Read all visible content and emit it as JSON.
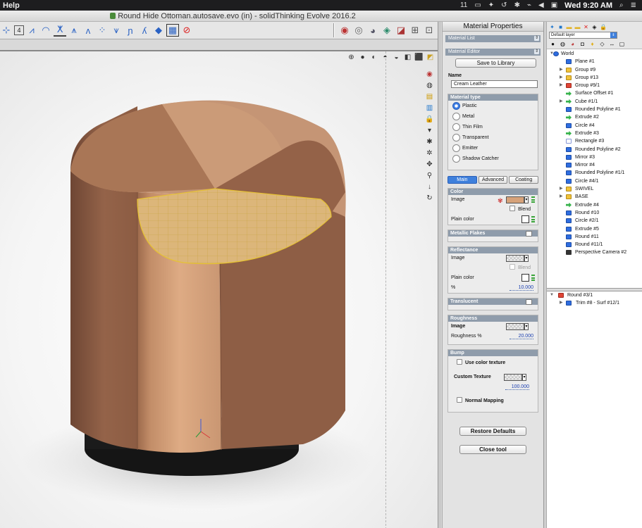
{
  "menubar": {
    "help": "Help",
    "status_items": [
      "11",
      "▭",
      "✦",
      "↺",
      "✱",
      "⌁",
      "◀",
      "▣"
    ],
    "clock": "Wed 9:20 AM",
    "search_icon": "⌕",
    "list_icon": "≣"
  },
  "window": {
    "title": "Round Hide Ottoman.autosave.evo (in) - solidThinking Evolve 2016.2"
  },
  "material": {
    "panel_title": "Material Properties",
    "material_list_label": "Material List",
    "material_editor_label": "Material Editor",
    "save_library": "Save to Library",
    "name_label": "Name",
    "name_value": "Cream Leather",
    "material_type_label": "Material type",
    "types": [
      "Plastic",
      "Metal",
      "Thin Film",
      "Transparent",
      "Emitter",
      "Shadow Catcher"
    ],
    "tabs": [
      "Main",
      "Advanced",
      "Coating"
    ],
    "color": {
      "header": "Color",
      "image_label": "Image",
      "blend_label": "Blend",
      "plain_color_label": "Plain color"
    },
    "metallic_flakes": "Metallic Flakes",
    "reflectance": {
      "header": "Reflectance",
      "image_label": "Image",
      "blend_label": "Blend",
      "plain_color_label": "Plain color",
      "percent_label": "%",
      "percent_value": "10.000"
    },
    "translucent": "Translucent",
    "roughness": {
      "header": "Roughness",
      "image_label": "Image",
      "percent_label": "Roughness %",
      "percent_value": "20.000"
    },
    "bump": {
      "header": "Bump",
      "use_color_texture": "Use color texture",
      "custom_texture": "Custom Texture",
      "value": "100.000",
      "normal_mapping": "Normal Mapping"
    },
    "restore_defaults": "Restore Defaults",
    "close_tool": "Close tool"
  },
  "tree": {
    "layer": "Default layer",
    "root": "World",
    "items": [
      {
        "label": "Plane #1",
        "icon": "blue",
        "exp": false
      },
      {
        "label": "Group #9",
        "icon": "folder",
        "exp": true
      },
      {
        "label": "Group #13",
        "icon": "folder",
        "exp": true
      },
      {
        "label": "Group #9/1",
        "icon": "folder-red",
        "exp": true
      },
      {
        "label": "Surface Offset #1",
        "icon": "green",
        "exp": false
      },
      {
        "label": "Cube #1/1",
        "icon": "green",
        "exp": true
      },
      {
        "label": "Rounded Polyline #1",
        "icon": "blue",
        "exp": false
      },
      {
        "label": "Extrude #2",
        "icon": "green",
        "exp": false
      },
      {
        "label": "Circle #4",
        "icon": "blue",
        "exp": false
      },
      {
        "label": "Extrude #3",
        "icon": "green",
        "exp": false
      },
      {
        "label": "Rectangle #3",
        "icon": "outline",
        "exp": false
      },
      {
        "label": "Rounded Polyline #2",
        "icon": "blue",
        "exp": false
      },
      {
        "label": "Mirror #3",
        "icon": "blue",
        "exp": false
      },
      {
        "label": "Mirror #4",
        "icon": "blue",
        "exp": false
      },
      {
        "label": "Rounded Polyline #1/1",
        "icon": "blue",
        "exp": false
      },
      {
        "label": "Circle #4/1",
        "icon": "blue",
        "exp": false
      },
      {
        "label": "SWIVEL",
        "icon": "folder",
        "exp": true
      },
      {
        "label": "BASE",
        "icon": "folder",
        "exp": true
      },
      {
        "label": "Extrude #4",
        "icon": "green",
        "exp": false
      },
      {
        "label": "Round #10",
        "icon": "blue",
        "exp": false
      },
      {
        "label": "Circle #2/1",
        "icon": "blue",
        "exp": false
      },
      {
        "label": "Extrude #5",
        "icon": "blue",
        "exp": false
      },
      {
        "label": "Round #11",
        "icon": "blue",
        "exp": false
      },
      {
        "label": "Round #11/1",
        "icon": "blue",
        "exp": false
      },
      {
        "label": "Perspective Camera #2",
        "icon": "cam",
        "exp": false
      }
    ],
    "lower_items": [
      {
        "label": "Round #3/1",
        "icon": "red",
        "exp": true
      },
      {
        "label": "Trim #8 - Surf #12/1",
        "icon": "blue",
        "exp": true
      }
    ]
  },
  "colors": {
    "leather_light": "#d6a27a",
    "leather_dark": "#a37354",
    "selection": "#e6c233",
    "accent_blue": "#3f80dc"
  }
}
